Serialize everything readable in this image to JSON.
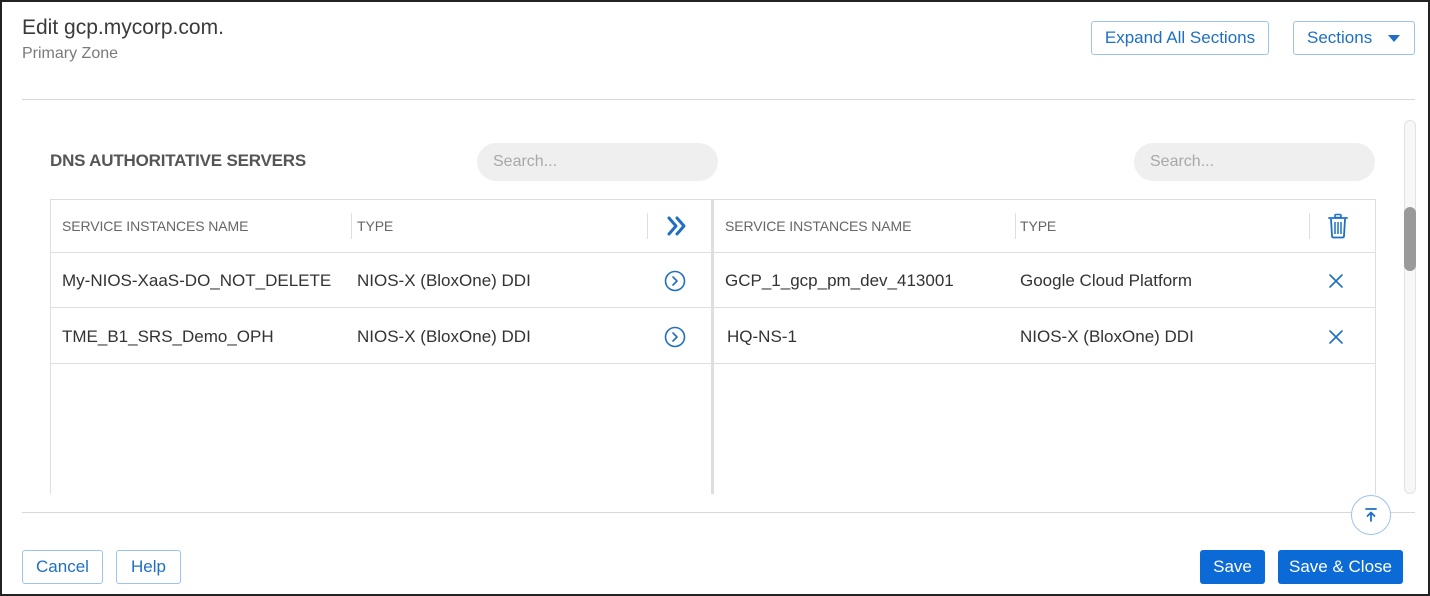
{
  "header": {
    "title": "Edit gcp.mycorp.com.",
    "subtitle": "Primary Zone",
    "expand_all_label": "Expand All Sections",
    "sections_label": "Sections"
  },
  "section": {
    "title": "DNS AUTHORITATIVE SERVERS",
    "left_search_placeholder": "Search...",
    "right_search_placeholder": "Search..."
  },
  "left_table": {
    "columns": [
      "SERVICE INSTANCES NAME",
      "TYPE"
    ],
    "header_action_icon": "double-chevron-right-icon",
    "row_action_icon": "circle-chevron-right-icon",
    "rows": [
      {
        "name": "My-NIOS-XaaS-DO_NOT_DELETE",
        "type": "NIOS-X (BloxOne) DDI"
      },
      {
        "name": "TME_B1_SRS_Demo_OPH",
        "type": "NIOS-X (BloxOne) DDI"
      }
    ]
  },
  "right_table": {
    "columns": [
      "SERVICE INSTANCES NAME",
      "TYPE"
    ],
    "header_action_icon": "trash-icon",
    "row_action_icon": "close-icon",
    "rows": [
      {
        "name": "GCP_1_gcp_pm_dev_413001",
        "type": "Google Cloud Platform"
      },
      {
        "name": "HQ-NS-1",
        "type": "NIOS-X (BloxOne) DDI"
      }
    ]
  },
  "footer": {
    "cancel_label": "Cancel",
    "help_label": "Help",
    "save_label": "Save",
    "save_close_label": "Save & Close"
  },
  "colors": {
    "accent": "#0b6ad6",
    "outline_border": "#9cc3ec",
    "link_text": "#1e6fc4"
  }
}
